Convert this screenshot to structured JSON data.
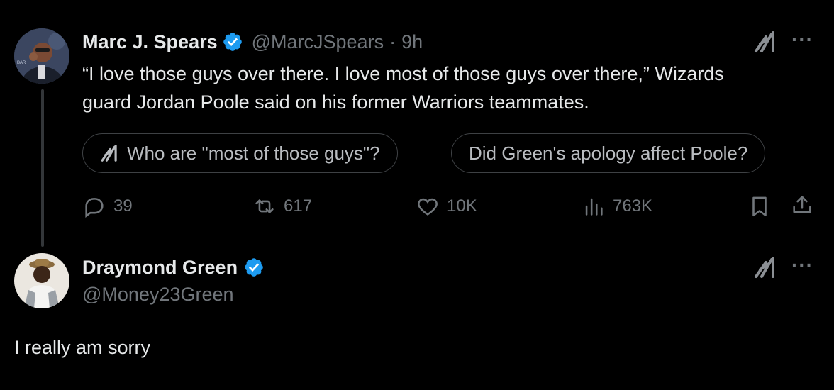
{
  "tweet1": {
    "author_name": "Marc J. Spears",
    "handle": "@MarcJSpears",
    "separator": "·",
    "time": "9h",
    "text_line1": "“I love those guys over there. I love most of those guys over there,” Wizards",
    "text_line2": "guard Jordan Poole  said on his former Warriors teammates.",
    "chips": [
      "Who are \"most of those guys\"?",
      "Did Green's apology affect Poole?"
    ],
    "actions": {
      "replies": "39",
      "retweets": "617",
      "likes": "10K",
      "views": "763K"
    }
  },
  "tweet2": {
    "author_name": "Draymond Green",
    "handle": "@Money23Green",
    "text": "I really am sorry"
  },
  "more_label": "···",
  "colors": {
    "background": "#000000",
    "text": "#e7e9ea",
    "muted": "#71767b",
    "verified_blue": "#1d9bf0"
  },
  "icons": [
    "grok-icon",
    "more-icon",
    "verified-badge-icon",
    "reply-icon",
    "retweet-icon",
    "like-icon",
    "views-icon",
    "bookmark-icon",
    "share-icon"
  ]
}
